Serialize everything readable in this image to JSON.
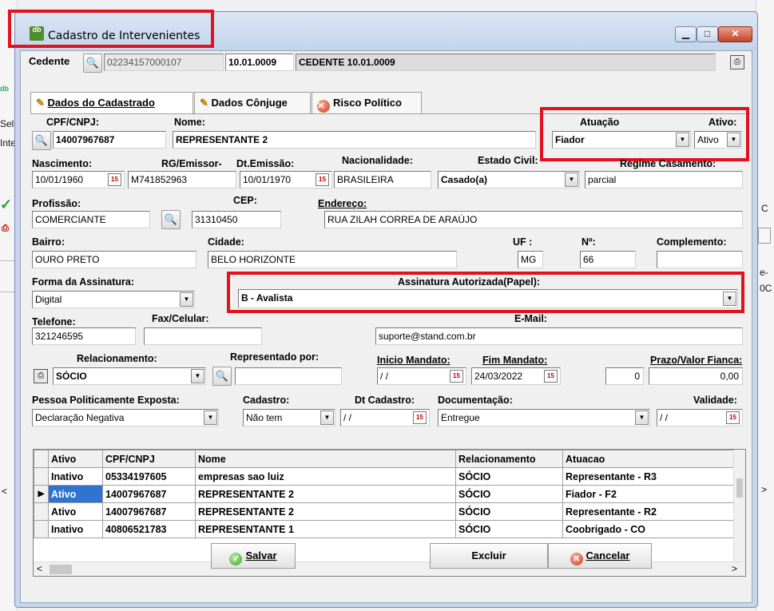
{
  "window": {
    "title": "Cadastro de Intervenientes",
    "app_icon_text": "db"
  },
  "background": {
    "left_texts": [
      "Sel",
      "Inte"
    ],
    "right_texts": [
      "C",
      "e-",
      "0C"
    ]
  },
  "cedente": {
    "label": "Cedente",
    "doc": "02234157000107",
    "code": "10.01.0009",
    "name": "CEDENTE 10.01.0009"
  },
  "tabs": [
    {
      "label": "Dados do Cadastrado",
      "underline": "D"
    },
    {
      "label": "Dados Cônjuge"
    },
    {
      "label": "Risco Político"
    }
  ],
  "form": {
    "cpf": {
      "label": "CPF/CNPJ:",
      "value": "14007967687"
    },
    "nome": {
      "label": "Nome:",
      "value": "REPRESENTANTE 2"
    },
    "atuacao": {
      "label": "Atuação",
      "value": "Fiador"
    },
    "ativo": {
      "label": "Ativo:",
      "value": "Ativo"
    },
    "nascimento": {
      "label": "Nascimento:",
      "value": "10/01/1960"
    },
    "rg": {
      "label": "RG/Emissor-",
      "value": "M741852963"
    },
    "dt_emissao": {
      "label": "Dt.Emissão:",
      "value": "10/01/1970"
    },
    "nacionalidade": {
      "label": "Nacionalidade:",
      "value": "BRASILEIRA"
    },
    "estado_civil": {
      "label": "Estado Civil:",
      "value": "Casado(a)"
    },
    "regime": {
      "label": "Regime Casamento:",
      "value": "parcial"
    },
    "profissao": {
      "label": "Profissão:",
      "value": "COMERCIANTE"
    },
    "cep": {
      "label": "CEP:",
      "value": "31310450"
    },
    "endereco": {
      "label": "Endereço:",
      "value": "RUA ZILAH CORREA DE ARAÚJO"
    },
    "bairro": {
      "label": "Bairro:",
      "value": "OURO PRETO"
    },
    "cidade": {
      "label": "Cidade:",
      "value": "BELO HORIZONTE"
    },
    "uf": {
      "label": "UF :",
      "value": "MG"
    },
    "numero": {
      "label": "Nº:",
      "value": "66"
    },
    "complemento": {
      "label": "Complemento:",
      "value": ""
    },
    "forma_assinatura": {
      "label": "Forma da Assinatura:",
      "value": "Digital"
    },
    "assinatura_autorizada": {
      "label": "Assinatura Autorizada(Papel):",
      "value": "B - Avalista"
    },
    "telefone": {
      "label": "Telefone:",
      "value": "321246595"
    },
    "fax": {
      "label": "Fax/Celular:",
      "value": ""
    },
    "email": {
      "label": "E-Mail:",
      "value": "suporte@stand.com.br"
    },
    "relacionamento": {
      "label": "Relacionamento:",
      "value": "SÓCIO"
    },
    "representado": {
      "label": "Representado por:",
      "value": ""
    },
    "inicio_mandato": {
      "label": "Inicio Mandato:",
      "value": "/ /"
    },
    "fim_mandato": {
      "label": "Fim Mandato:",
      "value": "24/03/2022"
    },
    "prazo": {
      "label": "Prazo/Valor Fianca:",
      "value": "0",
      "valor": "0,00"
    },
    "ppe": {
      "label": "Pessoa Politicamente Exposta:",
      "value": "Declaração Negativa"
    },
    "cadastro": {
      "label": "Cadastro:",
      "value": "Não tem"
    },
    "dt_cadastro": {
      "label": "Dt Cadastro:",
      "value": "/ /"
    },
    "documentacao": {
      "label": "Documentação:",
      "value": "Entregue"
    },
    "validade": {
      "label": "Validade:",
      "value": "/ /"
    }
  },
  "grid": {
    "columns": [
      "Ativo",
      "CPF/CNPJ",
      "Nome",
      "Relacionamento",
      "Atuacao"
    ],
    "rows": [
      [
        "Inativo",
        "05334197605",
        "empresas sao luiz",
        "SÓCIO",
        "Representante - R3"
      ],
      [
        "Ativo",
        "14007967687",
        "REPRESENTANTE 2",
        "SÓCIO",
        "Fiador - F2"
      ],
      [
        "Ativo",
        "14007967687",
        "REPRESENTANTE 2",
        "SÓCIO",
        "Representante - R2"
      ],
      [
        "Inativo",
        "40806521783",
        "REPRESENTANTE 1",
        "SÓCIO",
        "Coobrigado - CO"
      ]
    ],
    "selected_row": 1
  },
  "buttons": {
    "salvar": "Salvar",
    "excluir": "Excluir",
    "cancelar": "Cancelar"
  },
  "colors": {
    "highlight": "#e2121c",
    "selection": "#2f74d0",
    "title_bar": "#c7d6ea"
  }
}
